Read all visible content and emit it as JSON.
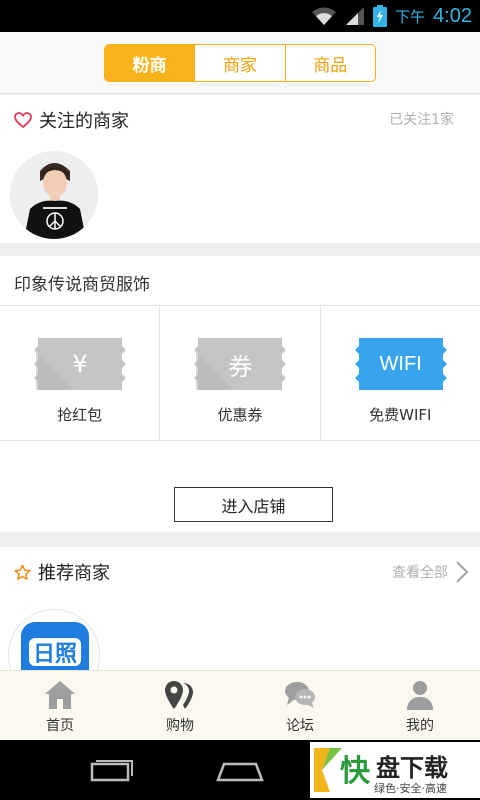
{
  "status_bar": {
    "period": "下午",
    "time": "4:02"
  },
  "top_tabs": [
    {
      "label": "粉商",
      "active": true
    },
    {
      "label": "商家",
      "active": false
    },
    {
      "label": "商品",
      "active": false
    }
  ],
  "followed": {
    "title": "关注的商家",
    "count_text": "已关注1家"
  },
  "store": {
    "name": "印象传说商贸服饰",
    "perks": [
      {
        "label": "抢红包",
        "ticket_text": "¥",
        "color": "#c4c4c4"
      },
      {
        "label": "优惠券",
        "ticket_text": "券",
        "color": "#c4c4c4"
      },
      {
        "label": "免费WIFI",
        "ticket_text": "WIFI",
        "color": "#38a4ee"
      }
    ],
    "enter_label": "进入店铺"
  },
  "recommend": {
    "title": "推荐商家",
    "more_label": "查看全部",
    "logo_text": "日照"
  },
  "bottom_nav": [
    {
      "label": "首页",
      "icon": "home-icon"
    },
    {
      "label": "购物",
      "icon": "map-pin-icon"
    },
    {
      "label": "论坛",
      "icon": "chat-bubbles-icon"
    },
    {
      "label": "我的",
      "icon": "user-icon"
    }
  ],
  "watermark": {
    "brand": "快",
    "text": "盘下载",
    "tagline": "绿色·安全·高速"
  },
  "colors": {
    "accent": "#f7b21c",
    "heart": "#e8395a",
    "star": "#f08a10",
    "wifi": "#38a4ee"
  }
}
